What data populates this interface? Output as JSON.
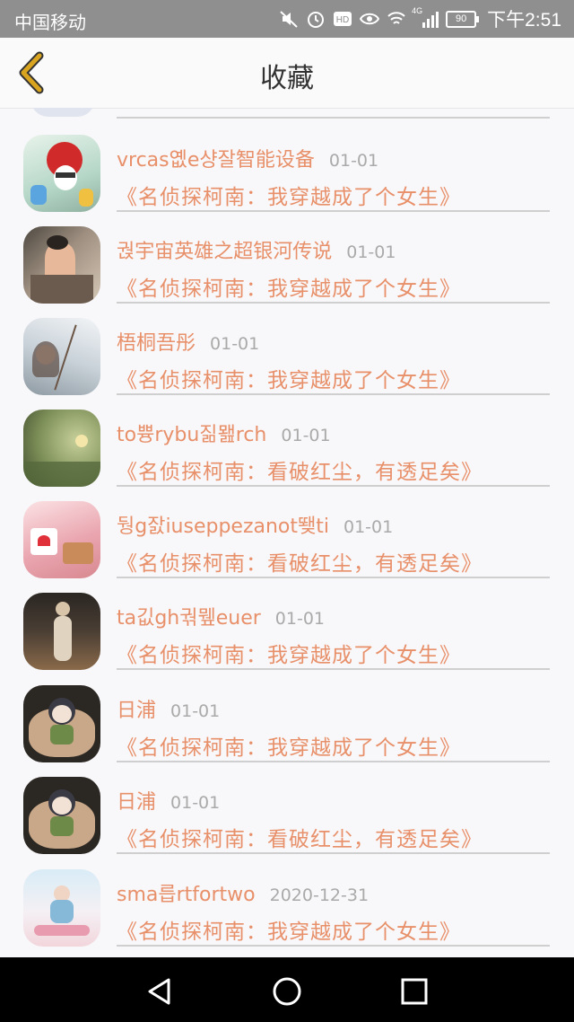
{
  "status_bar": {
    "carrier": "中国移动",
    "battery": "90",
    "signal_label": "4G",
    "time": "下午2:51",
    "icons": [
      "mute-icon",
      "alarm-icon",
      "hd-icon",
      "eye-icon",
      "wifi-icon",
      "signal-icon",
      "battery-icon"
    ]
  },
  "header": {
    "title": "收藏",
    "back_icon": "chevron-left-icon",
    "accent": "#d9a520"
  },
  "colors": {
    "accent": "#e8906a",
    "date": "#aaaaaa",
    "divider": "#cfcfcf"
  },
  "favorites": [
    {
      "name": "vrcas옚e샹잘智能设备",
      "date": "01-01",
      "book": "《名侦探柯南：我穿越成了个女生》"
    },
    {
      "name": "궍宇宙英雄之超银河传说",
      "date": "01-01",
      "book": "《名侦探柯南：我穿越成了个女生》"
    },
    {
      "name": "梧桐吾彤",
      "date": "01-01",
      "book": "《名侦探柯南：我穿越成了个女生》"
    },
    {
      "name": "to쁑rybu짊뫮rch",
      "date": "01-01",
      "book": "《名侦探柯南：看破红尘，有透足矣》"
    },
    {
      "name": "뒁g잜iuseppezanot뙞ti",
      "date": "01-01",
      "book": "《名侦探柯南：看破红尘，有透足矣》"
    },
    {
      "name": "ta깂gh궊뮆euer",
      "date": "01-01",
      "book": "《名侦探柯南：我穿越成了个女生》"
    },
    {
      "name": "日浦",
      "date": "01-01",
      "book": "《名侦探柯南：我穿越成了个女生》"
    },
    {
      "name": "日浦",
      "date": "01-01",
      "book": "《名侦探柯南：看破红尘，有透足矣》"
    },
    {
      "name": "sma릅rtfortwo",
      "date": "2020-12-31",
      "book": "《名侦探柯南：我穿越成了个女生》"
    }
  ],
  "nav_bar": {
    "icons": [
      "back-triangle-icon",
      "home-circle-icon",
      "recents-square-icon"
    ]
  }
}
